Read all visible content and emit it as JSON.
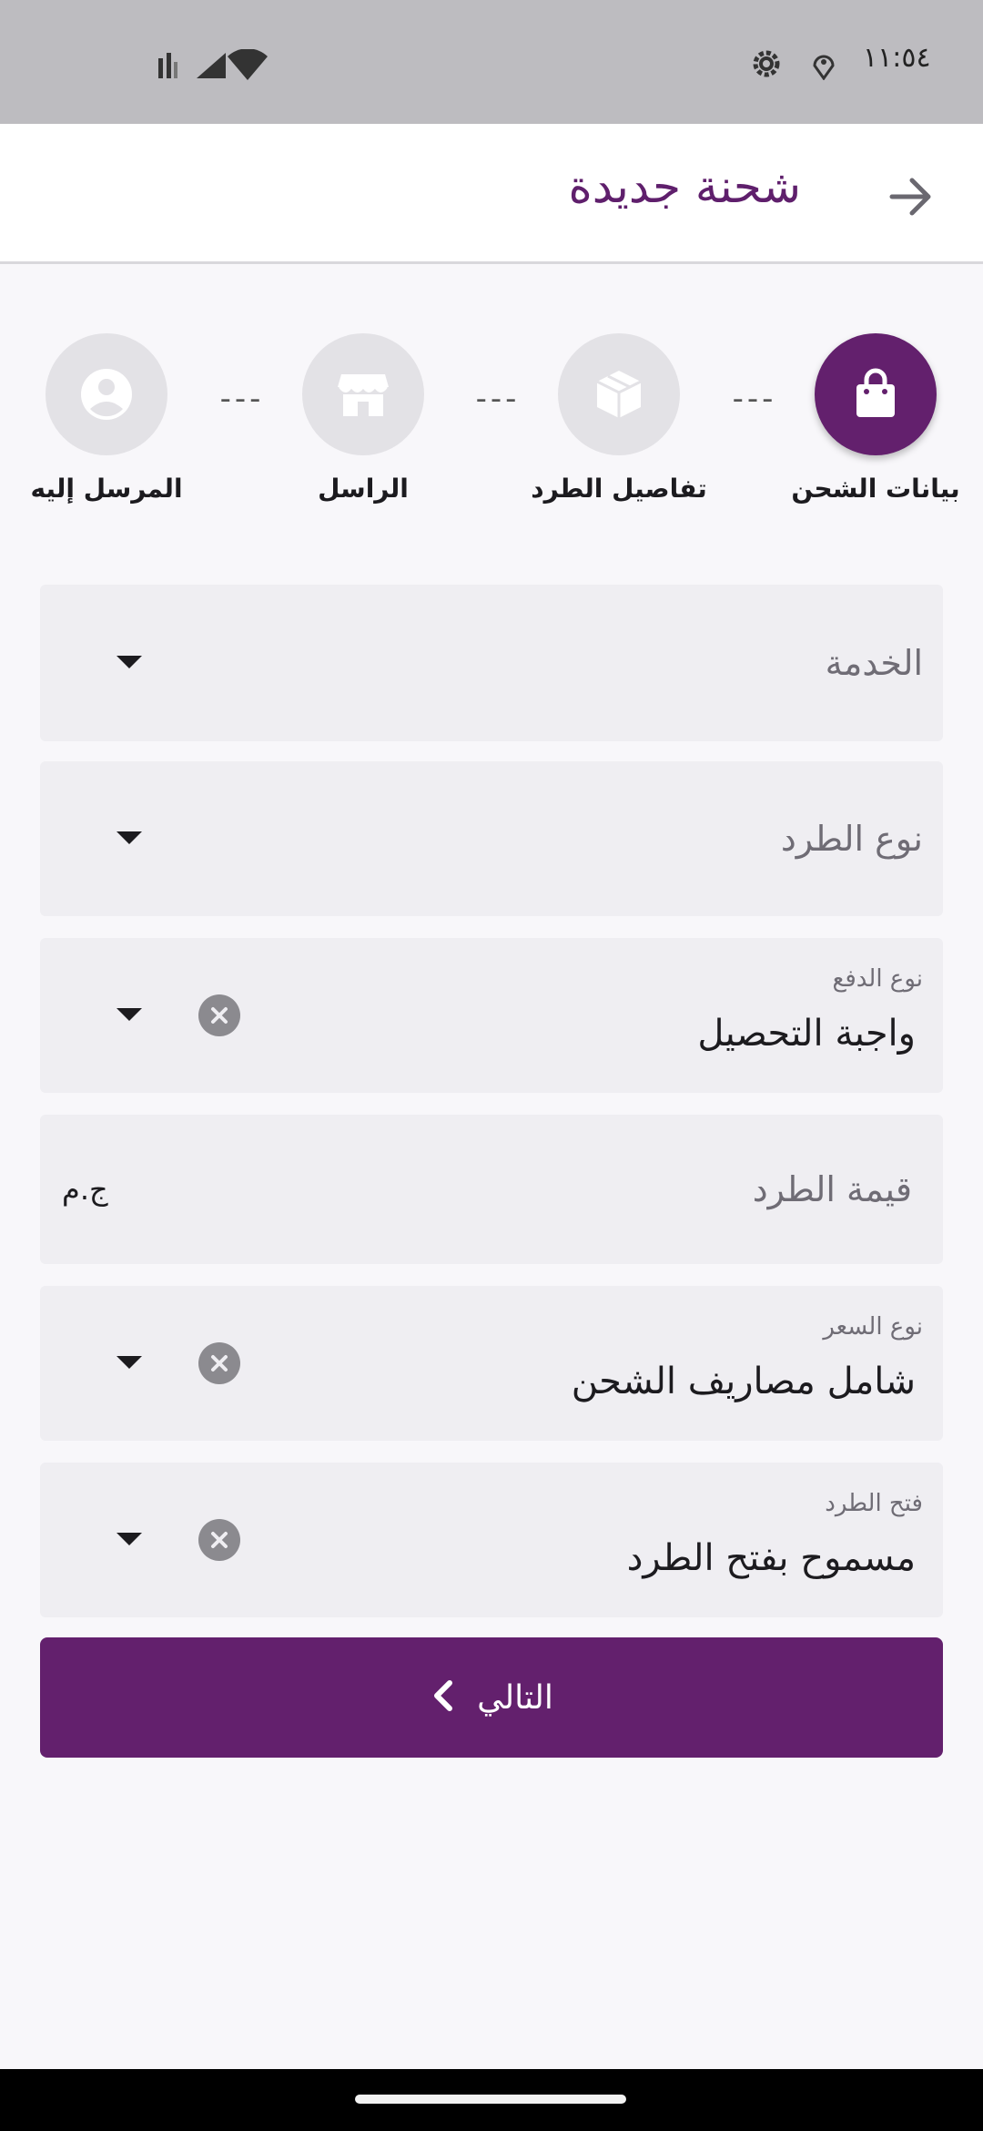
{
  "status_bar": {
    "time": "١١:٥٤",
    "icons": [
      "settings-gear-icon",
      "location-pin-icon",
      "wifi-icon",
      "cellular-signal-icon",
      "signal-bars-icon"
    ]
  },
  "app_bar": {
    "title": "شحنة جديدة",
    "back_icon": "arrow-icon"
  },
  "stepper": {
    "steps": [
      {
        "label": "بيانات الشحن",
        "icon": "shopping-bag-icon",
        "active": true
      },
      {
        "label": "تفاصيل الطرد",
        "icon": "package-box-icon",
        "active": false
      },
      {
        "label": "الراسل",
        "icon": "store-icon",
        "active": false
      },
      {
        "label": "المرسل إليه",
        "icon": "user-circle-icon",
        "active": false
      }
    ],
    "separator": "---"
  },
  "form": {
    "service": {
      "label": "الخدمة"
    },
    "parcel_type": {
      "label": "نوع الطرد"
    },
    "payment_type": {
      "label": "نوع الدفع",
      "value": "واجبة التحصيل"
    },
    "parcel_value": {
      "placeholder": "قيمة الطرد",
      "currency": "ج.م"
    },
    "price_type": {
      "label": "نوع السعر",
      "value": "شامل مصاريف الشحن"
    },
    "parcel_opening": {
      "label": "فتح الطرد",
      "value": "مسموح بفتح الطرد"
    }
  },
  "next_button": {
    "label": "التالي"
  },
  "colors": {
    "primary": "#63206d",
    "title": "#5f1f6c",
    "field_bg": "#efeef2",
    "inactive_step": "#e3e2e6"
  }
}
